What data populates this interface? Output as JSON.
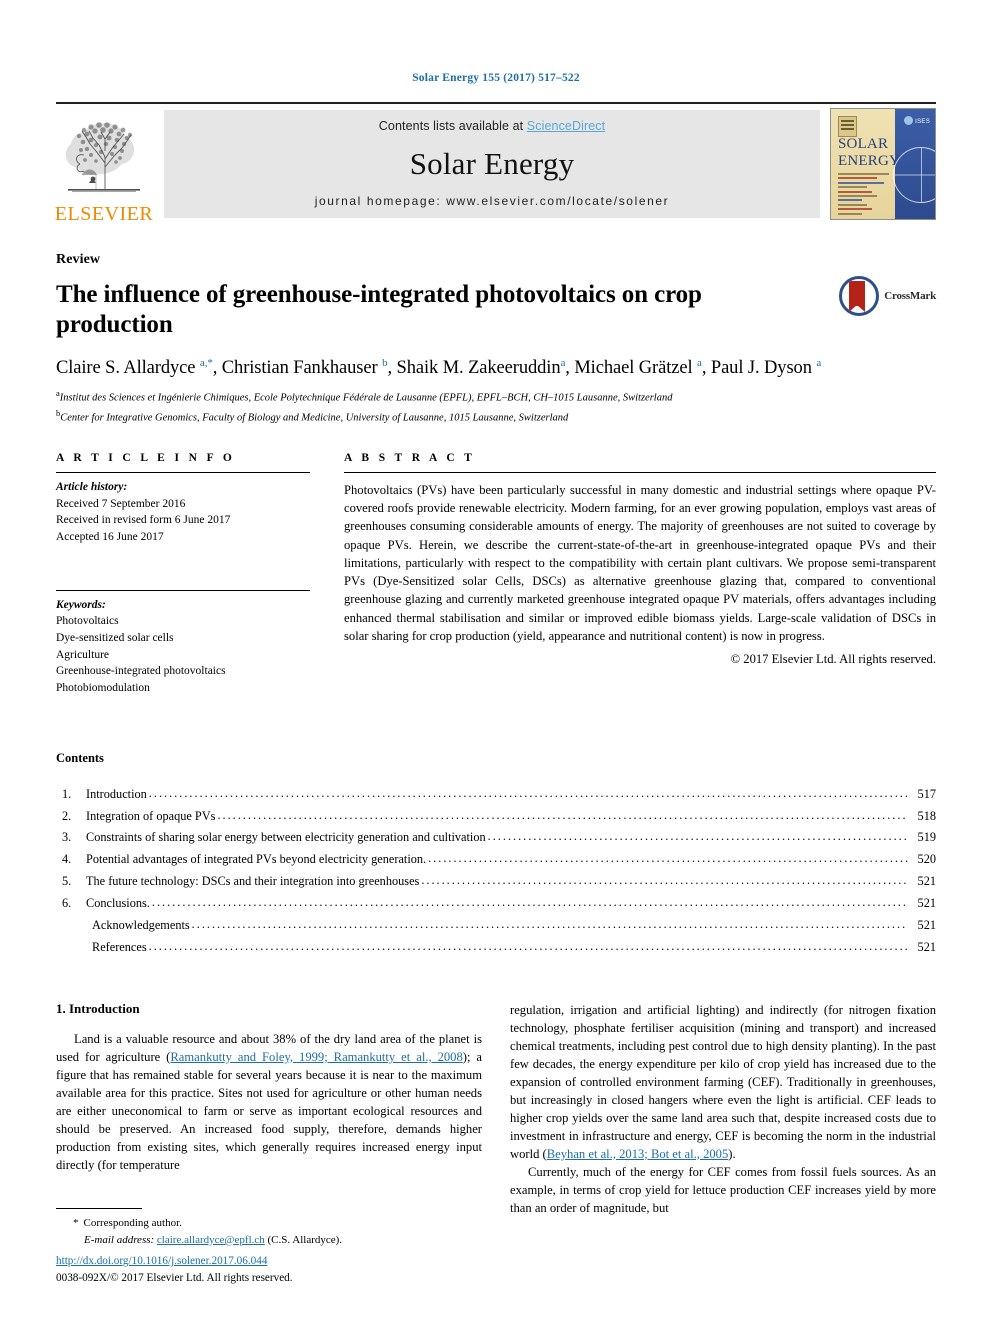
{
  "running_head": "Solar Energy 155 (2017) 517–522",
  "masthead": {
    "contents_prefix": "Contents lists available at ",
    "sciencedirect": "ScienceDirect",
    "journal_name": "Solar Energy",
    "homepage": "journal homepage: www.elsevier.com/locate/solener",
    "publisher": "ELSEVIER",
    "cover": {
      "title_line1": "SOLAR",
      "title_line2": "ENERGY",
      "society": "ISES"
    }
  },
  "article": {
    "type": "Review",
    "title": "The influence of greenhouse-integrated photovoltaics on crop production",
    "crossmark_label": "CrossMark",
    "authors_html": "Claire S. Allardyce <sup>a,*</sup>, Christian Fankhauser <sup>b</sup>, Shaik M. Zakeeruddin<sup>a</sup>, Michael Grätzel <sup>a</sup>, Paul J. Dyson <sup>a</sup>",
    "affiliations": [
      "Institut des Sciences et Ingénierie Chimiques, Ecole Polytechnique Fédérale de Lausanne (EPFL), EPFL–BCH, CH–1015 Lausanne, Switzerland",
      "Center for Integrative Genomics, Faculty of Biology and Medicine, University of Lausanne, 1015 Lausanne, Switzerland"
    ],
    "affiliation_marks": [
      "a",
      "b"
    ]
  },
  "article_info": {
    "heading": "A R T I C L E   I N F O",
    "history_label": "Article history:",
    "history": [
      "Received 7 September 2016",
      "Received in revised form 6 June 2017",
      "Accepted 16 June 2017"
    ],
    "keywords_label": "Keywords:",
    "keywords": [
      "Photovoltaics",
      "Dye-sensitized solar cells",
      "Agriculture",
      "Greenhouse-integrated photovoltaics",
      "Photobiomodulation"
    ]
  },
  "abstract": {
    "heading": "A B S T R A C T",
    "text": "Photovoltaics (PVs) have been particularly successful in many domestic and industrial settings where opaque PV-covered roofs provide renewable electricity. Modern farming, for an ever growing population, employs vast areas of greenhouses consuming considerable amounts of energy. The majority of greenhouses are not suited to coverage by opaque PVs. Herein, we describe the current-state-of-the-art in greenhouse-integrated opaque PVs and their limitations, particularly with respect to the compatibility with certain plant cultivars. We propose semi-transparent PVs (Dye-Sensitized solar Cells, DSCs) as alternative greenhouse glazing that, compared to conventional greenhouse glazing and currently marketed greenhouse integrated opaque PV materials, offers advantages including enhanced thermal stabilisation and similar or improved edible biomass yields. Large-scale validation of DSCs in solar sharing for crop production (yield, appearance and nutritional content) is now in progress.",
    "copyright": "© 2017 Elsevier Ltd. All rights reserved."
  },
  "contents": {
    "title": "Contents",
    "items": [
      {
        "num": "1.",
        "label": "Introduction",
        "page": "517",
        "indent": false
      },
      {
        "num": "2.",
        "label": "Integration of opaque PVs",
        "page": "518",
        "indent": false
      },
      {
        "num": "3.",
        "label": "Constraints of sharing solar energy between electricity generation and cultivation",
        "page": "519",
        "indent": false
      },
      {
        "num": "4.",
        "label": "Potential advantages of integrated PVs beyond electricity generation.",
        "page": "520",
        "indent": false
      },
      {
        "num": "5.",
        "label": "The future technology: DSCs and their integration into greenhouses",
        "page": "521",
        "indent": false
      },
      {
        "num": "6.",
        "label": "Conclusions.",
        "page": "521",
        "indent": false
      },
      {
        "num": "",
        "label": "Acknowledgements",
        "page": "521",
        "indent": true
      },
      {
        "num": "",
        "label": "References",
        "page": "521",
        "indent": true
      }
    ]
  },
  "intro": {
    "heading": "1. Introduction",
    "left_p1_a": "Land is a valuable resource and about 38% of the dry land area of the planet is used for agriculture (",
    "left_p1_cite": "Ramankutty and Foley, 1999; Ramankutty et al., 2008",
    "left_p1_b": "); a figure that has remained stable for several years because it is near to the maximum available area for this practice. Sites not used for agriculture or other human needs are either uneconomical to farm or serve as important ecological resources and should be preserved. An increased food supply, therefore, demands higher production from existing sites, which generally requires increased energy input directly (for temperature",
    "right_p1": "regulation, irrigation and artificial lighting) and indirectly (for nitrogen fixation technology, phosphate fertiliser acquisition (mining and transport) and increased chemical treatments, including pest control due to high density planting). In the past few decades, the energy expenditure per kilo of crop yield has increased due to the expansion of controlled environment farming (CEF). Traditionally in greenhouses, but increasingly in closed hangers where even the light is artificial. CEF leads to higher crop yields over the same land area such that, despite increased costs due to investment in infrastructure and energy, CEF is becoming the norm in the industrial world (",
    "right_p1_cite": "Beyhan et al., 2013; Bot et al., 2005",
    "right_p1_end": ").",
    "right_p2": "Currently, much of the energy for CEF comes from fossil fuels sources. As an example, in terms of crop yield for lettuce production CEF increases yield by more than an order of magnitude, but"
  },
  "footnote": {
    "star": "*",
    "corresponding": "Corresponding author.",
    "email_label": "E-mail address:",
    "email": "claire.allardyce@epfl.ch",
    "email_suffix": "(C.S. Allardyce)."
  },
  "doc_footer": {
    "doi": "http://dx.doi.org/10.1016/j.solener.2017.06.044",
    "issn_line": "0038-092X/© 2017 Elsevier Ltd. All rights reserved."
  },
  "colors": {
    "link_blue": "#1b6fa8",
    "sciencedirect_blue": "#5aa7d8",
    "elsevier_orange": "#ed8b00",
    "masthead_gray": "#e6e6e6",
    "crossmark_red": "#b32317",
    "crossmark_blue": "#2d4f8e"
  }
}
